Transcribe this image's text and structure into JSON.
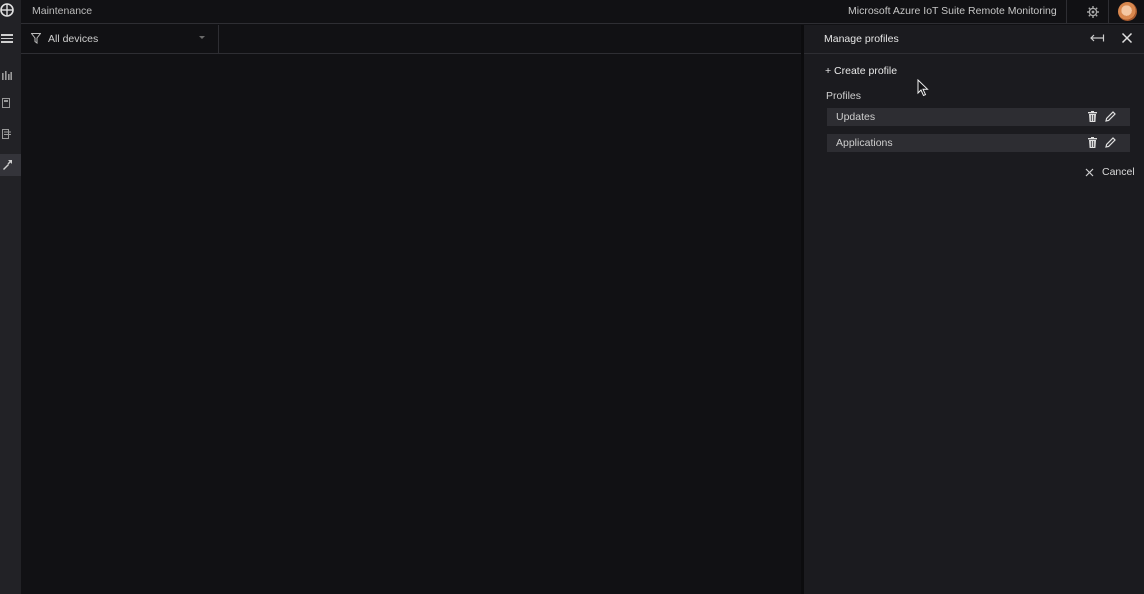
{
  "header": {
    "breadcrumb": "Maintenance",
    "product_name": "Microsoft Azure IoT Suite Remote Monitoring"
  },
  "filter": {
    "selected": "All devices"
  },
  "flyout": {
    "title": "Manage profiles",
    "create_label": "+ Create profile",
    "profiles_label": "Profiles",
    "profiles": [
      {
        "name": "Updates"
      },
      {
        "name": "Applications"
      }
    ],
    "cancel_label": "Cancel"
  },
  "icons": {
    "logo": "globe-logo-icon",
    "menu": "hamburger-menu-icon",
    "nav": [
      "dashboard-icon",
      "devices-icon",
      "rules-icon",
      "maintenance-icon"
    ],
    "filter": "funnel-icon",
    "settings": "gear-icon",
    "expand": "expand-arrow-icon",
    "close": "close-icon",
    "delete": "trash-icon",
    "edit": "pencil-icon"
  },
  "colors": {
    "background": "#111114",
    "rail": "#222226",
    "flyout": "#1b1b1f",
    "row": "#2d2d32"
  }
}
